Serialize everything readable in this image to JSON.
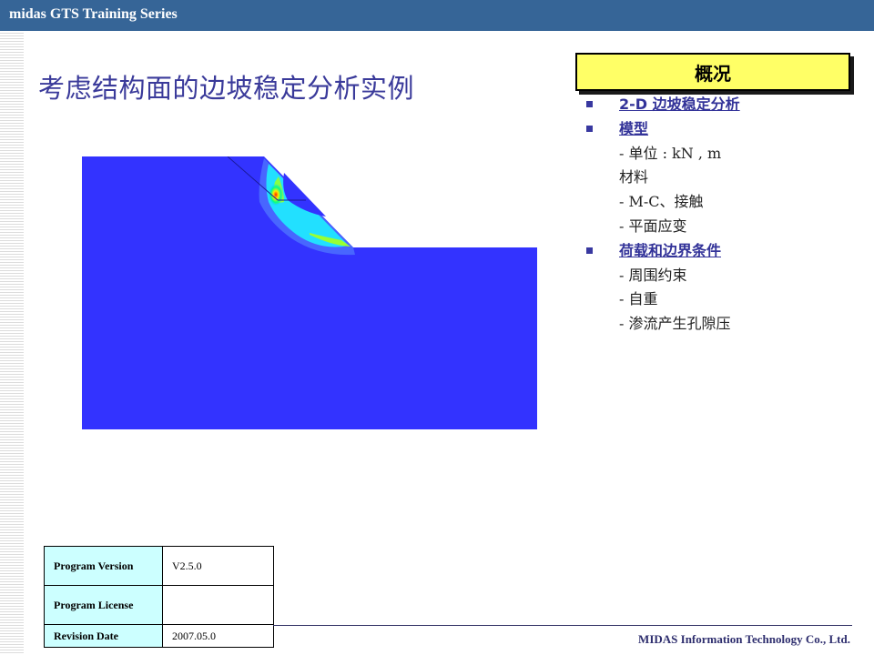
{
  "header": {
    "title": "midas GTS Training Series",
    "color": "#366597"
  },
  "page_title": "考虑结构面的边坡稳定分析实例",
  "figure": {
    "name": "slope-stability-contour",
    "background_color": "#3333ff"
  },
  "overview": {
    "title": "概况",
    "items": [
      {
        "type": "heading",
        "text": "2-D 边坡稳定分析"
      },
      {
        "type": "heading",
        "text": "模型"
      },
      {
        "type": "sub",
        "text": "- 单位 : kN , m"
      },
      {
        "type": "sub",
        "text": "材料"
      },
      {
        "type": "sub",
        "text": "- M-C、接触"
      },
      {
        "type": "sub",
        "text": "- 平面应变"
      },
      {
        "type": "heading",
        "text": "荷载和边界条件"
      },
      {
        "type": "sub",
        "text": "- 周围约束"
      },
      {
        "type": "sub",
        "text": "- 自重"
      },
      {
        "type": "sub",
        "text": "- 渗流产生孔隙压"
      }
    ]
  },
  "info_table": {
    "rows": [
      {
        "label": "Program Version",
        "value": "V2.5.0"
      },
      {
        "label": "Program License",
        "value": ""
      },
      {
        "label": "Revision Date",
        "value": "2007.05.0"
      }
    ]
  },
  "footer": {
    "company": "MIDAS Information Technology Co., Ltd."
  }
}
